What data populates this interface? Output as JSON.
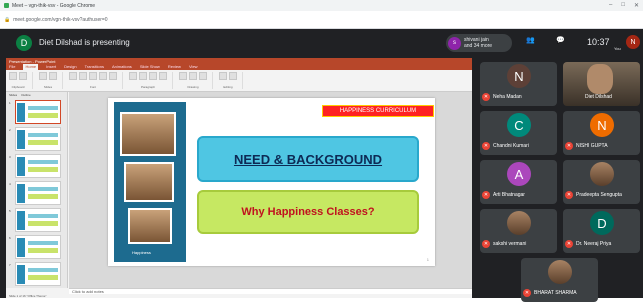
{
  "browser": {
    "title": "Meet – vgn-thik-vsv - Google Chrome",
    "url": "meet.google.com/vgn-thik-vsv?authuser=0",
    "window_controls": [
      "–",
      "□",
      "✕"
    ]
  },
  "meet": {
    "presenter_initial": "D",
    "presenting_text": "Diet Dilshad is presenting",
    "people_initial": "s",
    "people_line1": "shivani jain",
    "people_line2": "and 34 more",
    "clock": "10:37",
    "you_initial": "N",
    "you_label": "You"
  },
  "ppt": {
    "title_bar": "Presentation - PowerPoint",
    "tabs": [
      "File",
      "Home",
      "Insert",
      "Design",
      "Transitions",
      "Animations",
      "Slide Show",
      "Review",
      "View"
    ],
    "ribbon_groups": [
      "Clipboard",
      "Slides",
      "Font",
      "Paragraph",
      "Drawing",
      "Editing"
    ],
    "thumb_tabs": [
      "Slides",
      "Outline"
    ],
    "thumb_numbers": [
      "1",
      "2",
      "3",
      "4",
      "5",
      "6",
      "7"
    ],
    "notes": "Click to add notes",
    "status": "Slide 1 of 16   \"Office Theme\""
  },
  "slide": {
    "tag": "HAPPINESS CURRICULUM",
    "heading": "NEED & BACKGROUND",
    "subheading": "Why Happiness Classes?",
    "brand": "Happiness",
    "number": "1"
  },
  "participants": [
    {
      "name": "Neha Madan",
      "initial": "N",
      "color": "#5d4037",
      "photo": false
    },
    {
      "name": "Diet Dilshad",
      "initial": "",
      "color": "",
      "photo": true
    },
    {
      "name": "Chandni Kumari",
      "initial": "C",
      "color": "#00897b",
      "photo": false
    },
    {
      "name": "NISHI GUPTA",
      "initial": "N",
      "color": "#ef6c00",
      "photo": false
    },
    {
      "name": "Arti Bhatnagar",
      "initial": "A",
      "color": "#ab47bc",
      "photo": false
    },
    {
      "name": "Pradeepta Sengupta",
      "initial": "",
      "color": "",
      "photo": true
    },
    {
      "name": "sakshi vermani",
      "initial": "",
      "color": "",
      "photo": true
    },
    {
      "name": "Dr. Neeraj Priya",
      "initial": "D",
      "color": "#00695c",
      "photo": false
    },
    {
      "name": "BHARAT SHARMA",
      "initial": "",
      "color": "",
      "photo": true
    }
  ],
  "colors": {
    "meet_bg": "#202124",
    "ppt_accent": "#b7472a",
    "mic_off": "#ea4335"
  }
}
